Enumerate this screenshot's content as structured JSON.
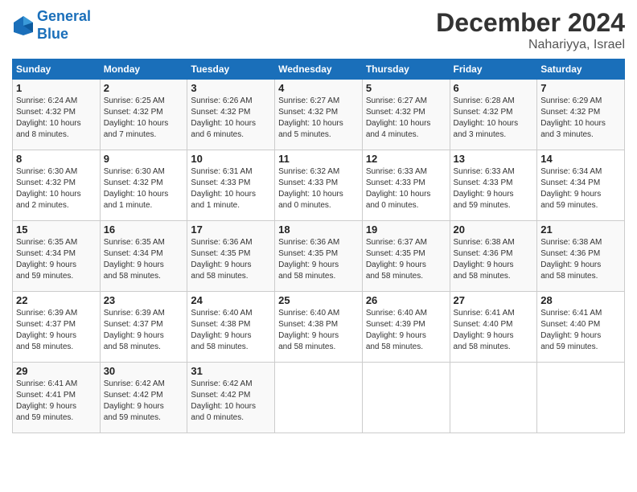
{
  "logo": {
    "line1": "General",
    "line2": "Blue"
  },
  "title": "December 2024",
  "location": "Nahariyya, Israel",
  "columns": [
    "Sunday",
    "Monday",
    "Tuesday",
    "Wednesday",
    "Thursday",
    "Friday",
    "Saturday"
  ],
  "weeks": [
    [
      {
        "day": "1",
        "info": "Sunrise: 6:24 AM\nSunset: 4:32 PM\nDaylight: 10 hours\nand 8 minutes."
      },
      {
        "day": "2",
        "info": "Sunrise: 6:25 AM\nSunset: 4:32 PM\nDaylight: 10 hours\nand 7 minutes."
      },
      {
        "day": "3",
        "info": "Sunrise: 6:26 AM\nSunset: 4:32 PM\nDaylight: 10 hours\nand 6 minutes."
      },
      {
        "day": "4",
        "info": "Sunrise: 6:27 AM\nSunset: 4:32 PM\nDaylight: 10 hours\nand 5 minutes."
      },
      {
        "day": "5",
        "info": "Sunrise: 6:27 AM\nSunset: 4:32 PM\nDaylight: 10 hours\nand 4 minutes."
      },
      {
        "day": "6",
        "info": "Sunrise: 6:28 AM\nSunset: 4:32 PM\nDaylight: 10 hours\nand 3 minutes."
      },
      {
        "day": "7",
        "info": "Sunrise: 6:29 AM\nSunset: 4:32 PM\nDaylight: 10 hours\nand 3 minutes."
      }
    ],
    [
      {
        "day": "8",
        "info": "Sunrise: 6:30 AM\nSunset: 4:32 PM\nDaylight: 10 hours\nand 2 minutes."
      },
      {
        "day": "9",
        "info": "Sunrise: 6:30 AM\nSunset: 4:32 PM\nDaylight: 10 hours\nand 1 minute."
      },
      {
        "day": "10",
        "info": "Sunrise: 6:31 AM\nSunset: 4:33 PM\nDaylight: 10 hours\nand 1 minute."
      },
      {
        "day": "11",
        "info": "Sunrise: 6:32 AM\nSunset: 4:33 PM\nDaylight: 10 hours\nand 0 minutes."
      },
      {
        "day": "12",
        "info": "Sunrise: 6:33 AM\nSunset: 4:33 PM\nDaylight: 10 hours\nand 0 minutes."
      },
      {
        "day": "13",
        "info": "Sunrise: 6:33 AM\nSunset: 4:33 PM\nDaylight: 9 hours\nand 59 minutes."
      },
      {
        "day": "14",
        "info": "Sunrise: 6:34 AM\nSunset: 4:34 PM\nDaylight: 9 hours\nand 59 minutes."
      }
    ],
    [
      {
        "day": "15",
        "info": "Sunrise: 6:35 AM\nSunset: 4:34 PM\nDaylight: 9 hours\nand 59 minutes."
      },
      {
        "day": "16",
        "info": "Sunrise: 6:35 AM\nSunset: 4:34 PM\nDaylight: 9 hours\nand 58 minutes."
      },
      {
        "day": "17",
        "info": "Sunrise: 6:36 AM\nSunset: 4:35 PM\nDaylight: 9 hours\nand 58 minutes."
      },
      {
        "day": "18",
        "info": "Sunrise: 6:36 AM\nSunset: 4:35 PM\nDaylight: 9 hours\nand 58 minutes."
      },
      {
        "day": "19",
        "info": "Sunrise: 6:37 AM\nSunset: 4:35 PM\nDaylight: 9 hours\nand 58 minutes."
      },
      {
        "day": "20",
        "info": "Sunrise: 6:38 AM\nSunset: 4:36 PM\nDaylight: 9 hours\nand 58 minutes."
      },
      {
        "day": "21",
        "info": "Sunrise: 6:38 AM\nSunset: 4:36 PM\nDaylight: 9 hours\nand 58 minutes."
      }
    ],
    [
      {
        "day": "22",
        "info": "Sunrise: 6:39 AM\nSunset: 4:37 PM\nDaylight: 9 hours\nand 58 minutes."
      },
      {
        "day": "23",
        "info": "Sunrise: 6:39 AM\nSunset: 4:37 PM\nDaylight: 9 hours\nand 58 minutes."
      },
      {
        "day": "24",
        "info": "Sunrise: 6:40 AM\nSunset: 4:38 PM\nDaylight: 9 hours\nand 58 minutes."
      },
      {
        "day": "25",
        "info": "Sunrise: 6:40 AM\nSunset: 4:38 PM\nDaylight: 9 hours\nand 58 minutes."
      },
      {
        "day": "26",
        "info": "Sunrise: 6:40 AM\nSunset: 4:39 PM\nDaylight: 9 hours\nand 58 minutes."
      },
      {
        "day": "27",
        "info": "Sunrise: 6:41 AM\nSunset: 4:40 PM\nDaylight: 9 hours\nand 58 minutes."
      },
      {
        "day": "28",
        "info": "Sunrise: 6:41 AM\nSunset: 4:40 PM\nDaylight: 9 hours\nand 59 minutes."
      }
    ],
    [
      {
        "day": "29",
        "info": "Sunrise: 6:41 AM\nSunset: 4:41 PM\nDaylight: 9 hours\nand 59 minutes."
      },
      {
        "day": "30",
        "info": "Sunrise: 6:42 AM\nSunset: 4:42 PM\nDaylight: 9 hours\nand 59 minutes."
      },
      {
        "day": "31",
        "info": "Sunrise: 6:42 AM\nSunset: 4:42 PM\nDaylight: 10 hours\nand 0 minutes."
      },
      {
        "day": "",
        "info": ""
      },
      {
        "day": "",
        "info": ""
      },
      {
        "day": "",
        "info": ""
      },
      {
        "day": "",
        "info": ""
      }
    ]
  ]
}
